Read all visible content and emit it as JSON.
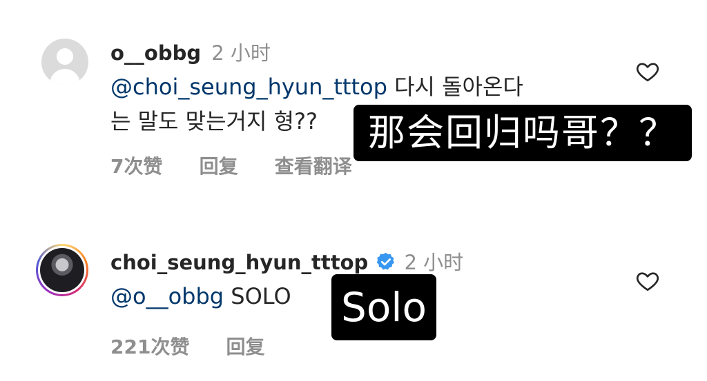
{
  "comments": [
    {
      "username": "o__obbg",
      "time": "2 小时",
      "mention": "@choi_seung_hyun_tttop",
      "text_line1": " 다시 돌아온다",
      "text_line2": "는 말도 맞는거지 형??",
      "likes": "7次赞",
      "reply": "回复",
      "translate": "查看翻译",
      "overlay": "那会回归吗哥？？"
    },
    {
      "username": "choi_seung_hyun_tttop",
      "time": "2 小时",
      "mention": "@o__obbg",
      "text_line1": " SOLO",
      "likes": "221次赞",
      "reply": "回复",
      "overlay": "Solo"
    }
  ],
  "icons": {
    "avatar1": "default-user-icon",
    "verified": "verified-badge-icon",
    "heart": "heart-outline-icon"
  },
  "colors": {
    "mention": "#00376b",
    "verified": "#3897f0",
    "muted": "#8e8e8e"
  }
}
